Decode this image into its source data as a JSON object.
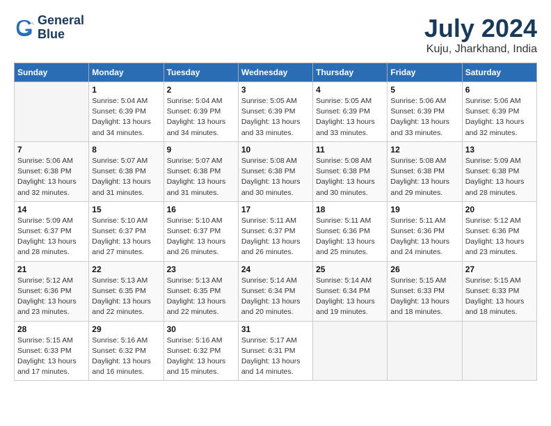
{
  "header": {
    "logo_line1": "General",
    "logo_line2": "Blue",
    "month": "July 2024",
    "location": "Kuju, Jharkhand, India"
  },
  "columns": [
    "Sunday",
    "Monday",
    "Tuesday",
    "Wednesday",
    "Thursday",
    "Friday",
    "Saturday"
  ],
  "weeks": [
    [
      {
        "day": "",
        "info": ""
      },
      {
        "day": "1",
        "info": "Sunrise: 5:04 AM\nSunset: 6:39 PM\nDaylight: 13 hours\nand 34 minutes."
      },
      {
        "day": "2",
        "info": "Sunrise: 5:04 AM\nSunset: 6:39 PM\nDaylight: 13 hours\nand 34 minutes."
      },
      {
        "day": "3",
        "info": "Sunrise: 5:05 AM\nSunset: 6:39 PM\nDaylight: 13 hours\nand 33 minutes."
      },
      {
        "day": "4",
        "info": "Sunrise: 5:05 AM\nSunset: 6:39 PM\nDaylight: 13 hours\nand 33 minutes."
      },
      {
        "day": "5",
        "info": "Sunrise: 5:06 AM\nSunset: 6:39 PM\nDaylight: 13 hours\nand 33 minutes."
      },
      {
        "day": "6",
        "info": "Sunrise: 5:06 AM\nSunset: 6:39 PM\nDaylight: 13 hours\nand 32 minutes."
      }
    ],
    [
      {
        "day": "7",
        "info": "Sunrise: 5:06 AM\nSunset: 6:38 PM\nDaylight: 13 hours\nand 32 minutes."
      },
      {
        "day": "8",
        "info": "Sunrise: 5:07 AM\nSunset: 6:38 PM\nDaylight: 13 hours\nand 31 minutes."
      },
      {
        "day": "9",
        "info": "Sunrise: 5:07 AM\nSunset: 6:38 PM\nDaylight: 13 hours\nand 31 minutes."
      },
      {
        "day": "10",
        "info": "Sunrise: 5:08 AM\nSunset: 6:38 PM\nDaylight: 13 hours\nand 30 minutes."
      },
      {
        "day": "11",
        "info": "Sunrise: 5:08 AM\nSunset: 6:38 PM\nDaylight: 13 hours\nand 30 minutes."
      },
      {
        "day": "12",
        "info": "Sunrise: 5:08 AM\nSunset: 6:38 PM\nDaylight: 13 hours\nand 29 minutes."
      },
      {
        "day": "13",
        "info": "Sunrise: 5:09 AM\nSunset: 6:38 PM\nDaylight: 13 hours\nand 28 minutes."
      }
    ],
    [
      {
        "day": "14",
        "info": "Sunrise: 5:09 AM\nSunset: 6:37 PM\nDaylight: 13 hours\nand 28 minutes."
      },
      {
        "day": "15",
        "info": "Sunrise: 5:10 AM\nSunset: 6:37 PM\nDaylight: 13 hours\nand 27 minutes."
      },
      {
        "day": "16",
        "info": "Sunrise: 5:10 AM\nSunset: 6:37 PM\nDaylight: 13 hours\nand 26 minutes."
      },
      {
        "day": "17",
        "info": "Sunrise: 5:11 AM\nSunset: 6:37 PM\nDaylight: 13 hours\nand 26 minutes."
      },
      {
        "day": "18",
        "info": "Sunrise: 5:11 AM\nSunset: 6:36 PM\nDaylight: 13 hours\nand 25 minutes."
      },
      {
        "day": "19",
        "info": "Sunrise: 5:11 AM\nSunset: 6:36 PM\nDaylight: 13 hours\nand 24 minutes."
      },
      {
        "day": "20",
        "info": "Sunrise: 5:12 AM\nSunset: 6:36 PM\nDaylight: 13 hours\nand 23 minutes."
      }
    ],
    [
      {
        "day": "21",
        "info": "Sunrise: 5:12 AM\nSunset: 6:36 PM\nDaylight: 13 hours\nand 23 minutes."
      },
      {
        "day": "22",
        "info": "Sunrise: 5:13 AM\nSunset: 6:35 PM\nDaylight: 13 hours\nand 22 minutes."
      },
      {
        "day": "23",
        "info": "Sunrise: 5:13 AM\nSunset: 6:35 PM\nDaylight: 13 hours\nand 22 minutes."
      },
      {
        "day": "24",
        "info": "Sunrise: 5:14 AM\nSunset: 6:34 PM\nDaylight: 13 hours\nand 20 minutes."
      },
      {
        "day": "25",
        "info": "Sunrise: 5:14 AM\nSunset: 6:34 PM\nDaylight: 13 hours\nand 19 minutes."
      },
      {
        "day": "26",
        "info": "Sunrise: 5:15 AM\nSunset: 6:33 PM\nDaylight: 13 hours\nand 18 minutes."
      },
      {
        "day": "27",
        "info": "Sunrise: 5:15 AM\nSunset: 6:33 PM\nDaylight: 13 hours\nand 18 minutes."
      }
    ],
    [
      {
        "day": "28",
        "info": "Sunrise: 5:15 AM\nSunset: 6:33 PM\nDaylight: 13 hours\nand 17 minutes."
      },
      {
        "day": "29",
        "info": "Sunrise: 5:16 AM\nSunset: 6:32 PM\nDaylight: 13 hours\nand 16 minutes."
      },
      {
        "day": "30",
        "info": "Sunrise: 5:16 AM\nSunset: 6:32 PM\nDaylight: 13 hours\nand 15 minutes."
      },
      {
        "day": "31",
        "info": "Sunrise: 5:17 AM\nSunset: 6:31 PM\nDaylight: 13 hours\nand 14 minutes."
      },
      {
        "day": "",
        "info": ""
      },
      {
        "day": "",
        "info": ""
      },
      {
        "day": "",
        "info": ""
      }
    ]
  ]
}
